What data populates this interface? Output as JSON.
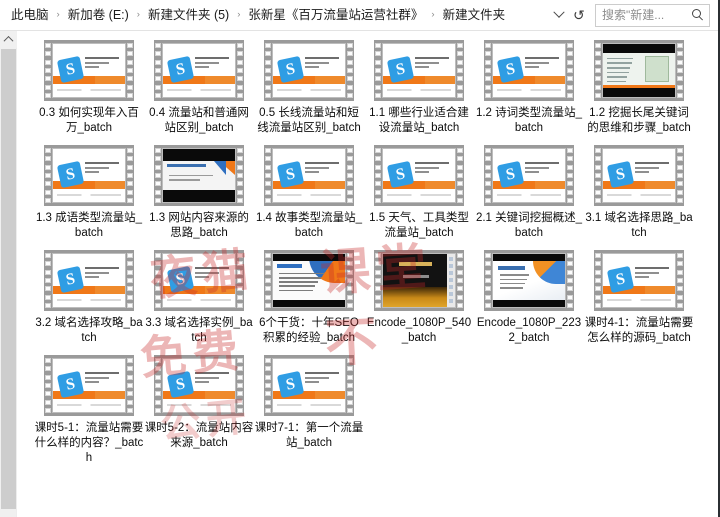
{
  "window": {
    "title": "新建文件夹"
  },
  "addressbar": {
    "breadcrumbs": [
      "此电脑",
      "新加卷 (E:)",
      "新建文件夹 (5)",
      "张新星《百万流量站运营社群》",
      "新建文件夹"
    ],
    "separator": "›",
    "history_dropdown_name": "chevron-down-icon",
    "refresh_glyph": "↻",
    "search_placeholder": "搜索\"新建...",
    "search_value": ""
  },
  "scrollbar": {
    "up_arrow": "▲",
    "position": "top"
  },
  "watermark": {
    "lines": [
      "夜猫",
      "课堂",
      "免费",
      "不",
      "公开"
    ],
    "color": "#c82828"
  },
  "files": [
    {
      "name": "0.3 如何实现年入百万_batch",
      "thumb": "sl-default"
    },
    {
      "name": "0.4 流量站和普通网站区别_batch",
      "thumb": "sl-default"
    },
    {
      "name": "0.5 长线流量站和短线流量站区别_batch",
      "thumb": "sl-default"
    },
    {
      "name": "1.1 哪些行业适合建设流量站_batch",
      "thumb": "sl-default"
    },
    {
      "name": "1.2 诗词类型流量站_batch",
      "thumb": "sl-default"
    },
    {
      "name": "1.2 挖掘长尾关键词的思维和步骤_batch",
      "thumb": "sl-shot"
    },
    {
      "name": "1.3 成语类型流量站_batch",
      "thumb": "sl-default"
    },
    {
      "name": "1.3 网站内容来源的思路_batch",
      "thumb": "sl-letterbox"
    },
    {
      "name": "1.4 故事类型流量站_batch",
      "thumb": "sl-default"
    },
    {
      "name": "1.5 天气、工具类型流量站_batch",
      "thumb": "sl-default"
    },
    {
      "name": "2.1 关键词挖掘概述_batch",
      "thumb": "sl-default"
    },
    {
      "name": "3.1 域名选择思路_batch",
      "thumb": "sl-default"
    },
    {
      "name": "3.2 域名选择攻略_batch",
      "thumb": "sl-default"
    },
    {
      "name": "3.3 域名选择实例_batch",
      "thumb": "sl-default"
    },
    {
      "name": "6个干货：十年SEO积累的经验_batch",
      "thumb": "sl-bullets"
    },
    {
      "name": "Encode_1080P_540_batch",
      "thumb": "sl-dark"
    },
    {
      "name": "Encode_1080P_2232_batch",
      "thumb": "sl-swoosh"
    },
    {
      "name": "课时4-1：流量站需要怎么样的源码_batch",
      "thumb": "sl-default"
    },
    {
      "name": "课时5-1：流量站需要什么样的内容？_batch",
      "thumb": "sl-default"
    },
    {
      "name": "课时5-2：流量站内容来源_batch",
      "thumb": "sl-default"
    },
    {
      "name": "课时7-1：第一个流量站_batch",
      "thumb": "sl-default"
    }
  ],
  "logo_letter": "S"
}
